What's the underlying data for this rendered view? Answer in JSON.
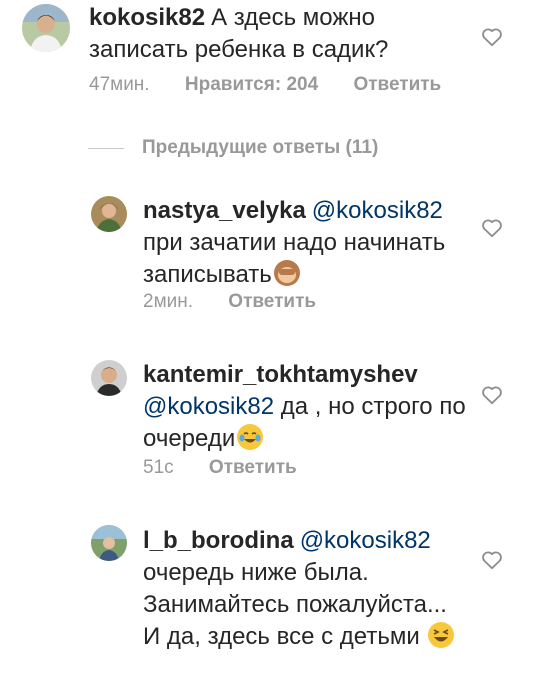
{
  "comments": [
    {
      "username": "kokosik82",
      "text": "А здесь можно записать ребенка в садик?",
      "time": "47мин.",
      "likes": "Нравится: 204",
      "reply": "Ответить"
    },
    {
      "username": "nastya_velyka",
      "mention": "@kokosik82",
      "text": "при зачатии надо начинать записывать",
      "emoji": "see-no-evil-monkey",
      "time": "2мин.",
      "reply": "Ответить"
    },
    {
      "username": "kantemir_tokhtamyshev",
      "mention": "@kokosik82",
      "text": "да , но строго по очереди",
      "emoji": "tears-of-joy",
      "time": "51с",
      "reply": "Ответить"
    },
    {
      "username": "l_b_borodina",
      "mention": "@kokosik82",
      "text": "очередь ниже была. Занимайтесь пожалуйста... И да, здесь все с детьми",
      "emoji": "laughing-face"
    }
  ],
  "previous_replies": "Предыдущие ответы (11)",
  "icons": {
    "like": "heart-outline-icon"
  },
  "colors": {
    "mention": "#003569",
    "meta": "#999999",
    "text": "#262626"
  }
}
